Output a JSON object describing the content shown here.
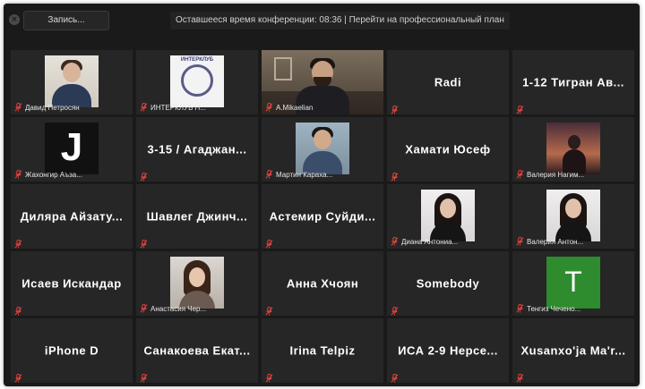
{
  "toolbar": {
    "record_label": "Запись...",
    "timer_text": "Оставшееся время конференции: 08:36 | Перейти на профессиональный план"
  },
  "colors": {
    "active_speaker_border": "#c6e23c",
    "tile_bg": "#262626",
    "muted_icon": "#e0443e"
  },
  "tiles": [
    {
      "name": "",
      "caption": "Давид Петросян",
      "kind": "photo",
      "avatar": "man-photo"
    },
    {
      "name": "",
      "caption": "ИНТЕРКЛУБ Н...",
      "kind": "photo",
      "avatar": "club-logo",
      "logo_text": "ИНТЕРКЛУБ"
    },
    {
      "name": "",
      "caption": "A.Mikaelian",
      "kind": "video",
      "avatar": "active-video"
    },
    {
      "name": "Radi",
      "caption": "",
      "kind": "name"
    },
    {
      "name": "1-12 Тигран Ав...",
      "caption": "",
      "kind": "name"
    },
    {
      "name": "",
      "caption": "Жахонгир Аъза...",
      "kind": "photo",
      "avatar": "j-logo",
      "logo_text": "J"
    },
    {
      "name": "3-15 / Агаджан...",
      "caption": "",
      "kind": "name"
    },
    {
      "name": "",
      "caption": "Мартин Караха...",
      "kind": "photo",
      "avatar": "man-photo-2"
    },
    {
      "name": "Хамати Юсеф",
      "caption": "",
      "kind": "name"
    },
    {
      "name": "",
      "caption": "Валерия Нагим...",
      "kind": "photo",
      "avatar": "sunset-photo"
    },
    {
      "name": "Диляра Айзату...",
      "caption": "",
      "kind": "name"
    },
    {
      "name": "Шавлег Джинч...",
      "caption": "",
      "kind": "name"
    },
    {
      "name": "Астемир Суйди...",
      "caption": "",
      "kind": "name"
    },
    {
      "name": "",
      "caption": "Диана Антониа...",
      "kind": "photo",
      "avatar": "woman-photo"
    },
    {
      "name": "",
      "caption": "Валерия Антон...",
      "kind": "photo",
      "avatar": "woman-photo"
    },
    {
      "name": "Исаев Искандар",
      "caption": "",
      "kind": "name"
    },
    {
      "name": "",
      "caption": "Анастасия Чер...",
      "kind": "photo",
      "avatar": "woman-photo-2"
    },
    {
      "name": "Анна Хчоян",
      "caption": "",
      "kind": "name"
    },
    {
      "name": "Somebody",
      "caption": "",
      "kind": "name"
    },
    {
      "name": "",
      "caption": "Тенгиз Чечено...",
      "kind": "photo",
      "avatar": "t-logo",
      "logo_text": "T"
    },
    {
      "name": "iPhone D",
      "caption": "",
      "kind": "name"
    },
    {
      "name": "Санакоева Екат...",
      "caption": "",
      "kind": "name"
    },
    {
      "name": "Irina Telpiz",
      "caption": "",
      "kind": "name"
    },
    {
      "name": "ИСА 2-9 Нерсе...",
      "caption": "",
      "kind": "name"
    },
    {
      "name": "Xusanxo'ja Ma'r...",
      "caption": "",
      "kind": "name"
    }
  ]
}
